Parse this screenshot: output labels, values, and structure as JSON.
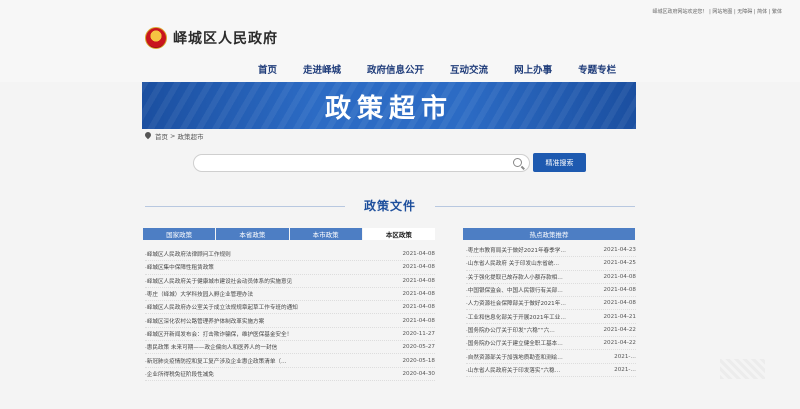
{
  "header": {
    "top_util": "峄城区政府网站欢迎您！ | 网站地图 | 无障碍 | 简体 | 繁体",
    "site_name": "峄城区人民政府",
    "nav": [
      "首页",
      "走进峄城",
      "政府信息公开",
      "互动交流",
      "网上办事",
      "专题专栏"
    ]
  },
  "banner": {
    "title": "政策超市"
  },
  "breadcrumb": {
    "home": "首页",
    "sep": ">",
    "current": "政策超市"
  },
  "search": {
    "placeholder": "",
    "button": "精准搜索"
  },
  "section": {
    "title": "政策文件"
  },
  "tabs": [
    "国家政策",
    "本省政策",
    "本市政策",
    "本区政策"
  ],
  "left_list": [
    {
      "title": "·峄城区人民政府法律顾问工作规则",
      "date": "2021-04-08"
    },
    {
      "title": "·峄城区集中保障性租赁政策",
      "date": "2021-04-08"
    },
    {
      "title": "·峄城区人民政府关于健康城市建设社会动员体系的实施意见",
      "date": "2021-04-08"
    },
    {
      "title": "·枣庄（峄城）大学科技园入孵企业管理办法",
      "date": "2021-04-08"
    },
    {
      "title": "·峄城区人民政府办公室关于成立法规规章起草工作专班的通知",
      "date": "2021-04-08"
    },
    {
      "title": "·峄城区深化农村公路管理养护体制改革实施方案",
      "date": "2021-04-08"
    },
    {
      "title": "·峄城区开新闻发布会：打击欺诈骗保，维护医保基金安全！",
      "date": "2020-11-27"
    },
    {
      "title": "·惠民政策 未来可期——政企偏向人和医养人的一封信",
      "date": "2020-05-27"
    },
    {
      "title": "·新冠肺炎疫情防控和复工复产涉及企业惠企政策清单（…",
      "date": "2020-05-18"
    },
    {
      "title": "·企业所得税免征阶段性减免",
      "date": "2020-04-30"
    }
  ],
  "hot": {
    "title": "热点政策推荐",
    "items": [
      {
        "title": "·枣庄市教育局关于做好2021年春季学…",
        "date": "2021-04-23"
      },
      {
        "title": "·山东省人民政府 关于印发山东省统…",
        "date": "2021-04-25"
      },
      {
        "title": "·关于强化提取已故存款人小额存款相…",
        "date": "2021-04-08"
      },
      {
        "title": "·中国银保监会、中国人民银行有关部…",
        "date": "2021-04-08"
      },
      {
        "title": "·人力资源社会保障部关于做好2021年…",
        "date": "2021-04-08"
      },
      {
        "title": "·工业和信息化部关于开展2021年工业…",
        "date": "2021-04-21"
      },
      {
        "title": "·国务院办公厅关于印发“六稳”“六…",
        "date": "2021-04-22"
      },
      {
        "title": "·国务院办公厅关于建立健全职工基本…",
        "date": "2021-04-22"
      },
      {
        "title": "·自然资源部关于加强地质勘查和测绘…",
        "date": "2021-…"
      },
      {
        "title": "·山东省人民政府关于印发落实“六稳…",
        "date": "2021-…"
      }
    ]
  }
}
